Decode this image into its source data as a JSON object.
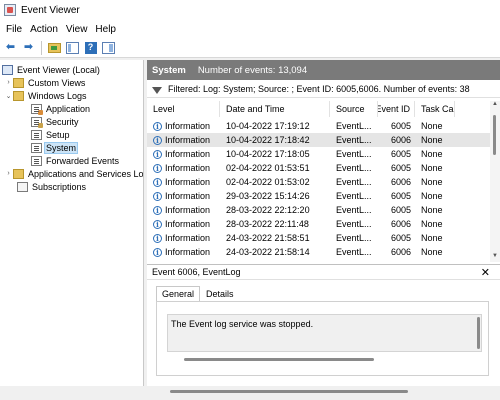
{
  "window": {
    "title": "Event Viewer"
  },
  "menu": [
    "File",
    "Action",
    "View",
    "Help"
  ],
  "tree": {
    "root": "Event Viewer (Local)",
    "custom_views": "Custom Views",
    "windows_logs": "Windows Logs",
    "logs": [
      "Application",
      "Security",
      "Setup",
      "System",
      "Forwarded Events"
    ],
    "apps_services": "Applications and Services Lo",
    "subscriptions": "Subscriptions"
  },
  "log_header": {
    "name": "System",
    "count_text": "Number of events: 13,094"
  },
  "filter_text": "Filtered: Log: System; Source: ; Event ID: 6005,6006. Number of events: 38",
  "columns": {
    "level": "Level",
    "date": "Date and Time",
    "source": "Source",
    "event_id": "Event ID",
    "task": "Task Ca..."
  },
  "events": [
    {
      "level": "Information",
      "date": "10-04-2022 17:19:12",
      "source": "EventL...",
      "id": "6005",
      "task": "None"
    },
    {
      "level": "Information",
      "date": "10-04-2022 17:18:42",
      "source": "EventL...",
      "id": "6006",
      "task": "None"
    },
    {
      "level": "Information",
      "date": "10-04-2022 17:18:05",
      "source": "EventL...",
      "id": "6005",
      "task": "None"
    },
    {
      "level": "Information",
      "date": "02-04-2022 01:53:51",
      "source": "EventL...",
      "id": "6005",
      "task": "None"
    },
    {
      "level": "Information",
      "date": "02-04-2022 01:53:02",
      "source": "EventL...",
      "id": "6006",
      "task": "None"
    },
    {
      "level": "Information",
      "date": "29-03-2022 15:14:26",
      "source": "EventL...",
      "id": "6005",
      "task": "None"
    },
    {
      "level": "Information",
      "date": "28-03-2022 22:12:20",
      "source": "EventL...",
      "id": "6005",
      "task": "None"
    },
    {
      "level": "Information",
      "date": "28-03-2022 22:11:48",
      "source": "EventL...",
      "id": "6006",
      "task": "None"
    },
    {
      "level": "Information",
      "date": "24-03-2022 21:58:51",
      "source": "EventL...",
      "id": "6005",
      "task": "None"
    },
    {
      "level": "Information",
      "date": "24-03-2022 21:58:14",
      "source": "EventL...",
      "id": "6006",
      "task": "None"
    }
  ],
  "detail": {
    "title": "Event 6006, EventLog",
    "tabs": [
      "General",
      "Details"
    ],
    "message": "The Event log service was stopped."
  }
}
